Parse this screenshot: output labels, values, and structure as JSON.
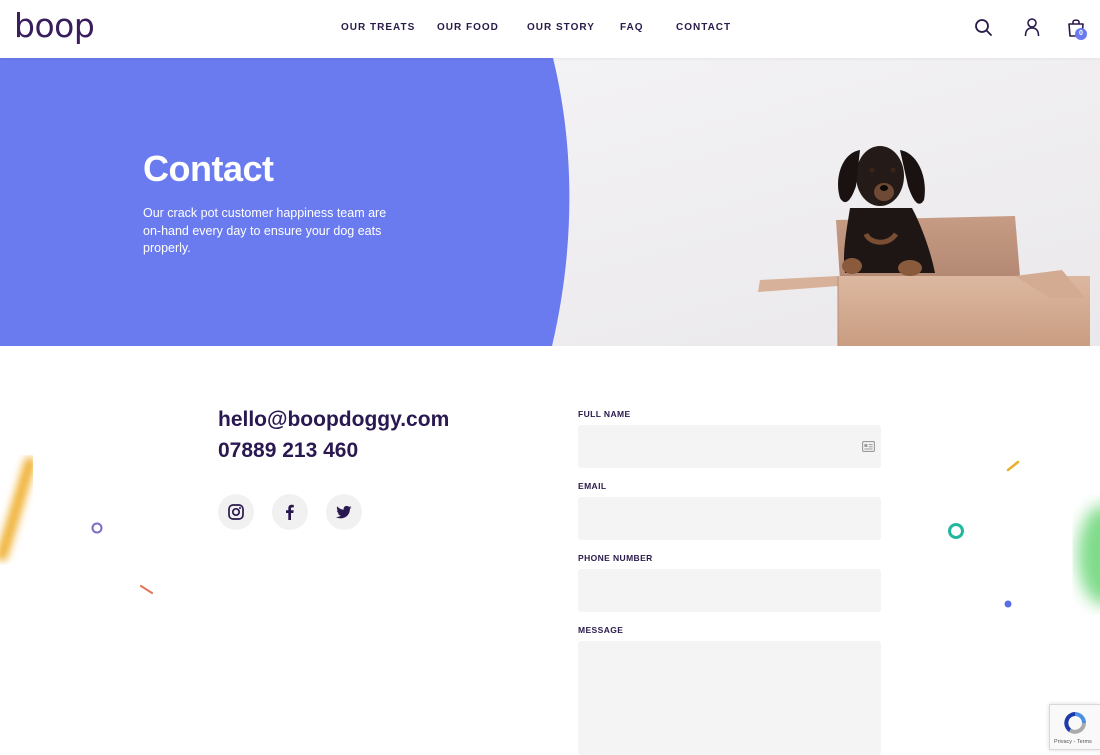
{
  "brand": {
    "logo_text": "boop",
    "color": "#3a1d5c",
    "accent": "#6a7bef"
  },
  "nav": {
    "items": [
      {
        "label": "OUR TREATS"
      },
      {
        "label": "OUR FOOD"
      },
      {
        "label": "OUR STORY"
      },
      {
        "label": "FAQ"
      },
      {
        "label": "CONTACT"
      }
    ]
  },
  "header_icons": {
    "search": "search-icon",
    "account": "user-icon",
    "cart": "shopping-bag-icon",
    "cart_count": "0"
  },
  "hero": {
    "title": "Contact",
    "text": "Our crack pot customer happiness team are on-hand every day to ensure your dog eats properly.",
    "panel_color": "#6a7bef",
    "image": "dachshund-in-cardboard-box"
  },
  "contact": {
    "email": "hello@boopdoggy.com",
    "phone": "07889 213 460",
    "social": [
      {
        "icon": "instagram-icon"
      },
      {
        "icon": "facebook-icon"
      },
      {
        "icon": "twitter-icon"
      }
    ]
  },
  "form": {
    "full_name_label": "FULL NAME",
    "full_name_value": "",
    "email_label": "EMAIL",
    "email_value": "",
    "phone_label": "PHONE NUMBER",
    "phone_value": "",
    "message_label": "MESSAGE",
    "message_value": ""
  },
  "recaptcha": {
    "text": "Privacy - Terms"
  }
}
